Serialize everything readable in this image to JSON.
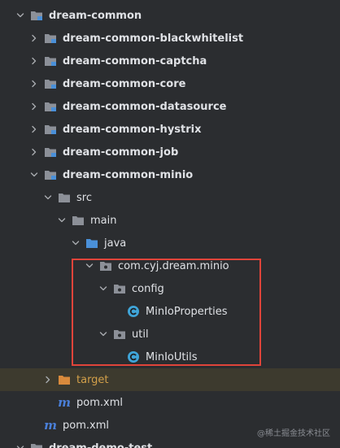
{
  "tree": {
    "rows": [
      {
        "label": "dream-common",
        "depth": 0,
        "expanded": true,
        "icon": "module-folder-icon",
        "bold": true
      },
      {
        "label": "dream-common-blackwhitelist",
        "depth": 1,
        "expanded": false,
        "icon": "module-folder-icon",
        "bold": true
      },
      {
        "label": "dream-common-captcha",
        "depth": 1,
        "expanded": false,
        "icon": "module-folder-icon",
        "bold": true
      },
      {
        "label": "dream-common-core",
        "depth": 1,
        "expanded": false,
        "icon": "module-folder-icon",
        "bold": true
      },
      {
        "label": "dream-common-datasource",
        "depth": 1,
        "expanded": false,
        "icon": "module-folder-icon",
        "bold": true
      },
      {
        "label": "dream-common-hystrix",
        "depth": 1,
        "expanded": false,
        "icon": "module-folder-icon",
        "bold": true
      },
      {
        "label": "dream-common-job",
        "depth": 1,
        "expanded": false,
        "icon": "module-folder-icon",
        "bold": true
      },
      {
        "label": "dream-common-minio",
        "depth": 1,
        "expanded": true,
        "icon": "module-folder-icon",
        "bold": true
      },
      {
        "label": "src",
        "depth": 2,
        "expanded": true,
        "icon": "folder-icon",
        "bold": false
      },
      {
        "label": "main",
        "depth": 3,
        "expanded": true,
        "icon": "folder-icon",
        "bold": false
      },
      {
        "label": "java",
        "depth": 4,
        "expanded": true,
        "icon": "source-folder-icon",
        "bold": false
      },
      {
        "label": "com.cyj.dream.minio",
        "depth": 5,
        "expanded": true,
        "icon": "package-icon",
        "bold": false
      },
      {
        "label": "config",
        "depth": 6,
        "expanded": true,
        "icon": "package-icon",
        "bold": false
      },
      {
        "label": "MinIoProperties",
        "depth": 7,
        "expanded": null,
        "icon": "java-class-icon",
        "bold": false
      },
      {
        "label": "util",
        "depth": 6,
        "expanded": true,
        "icon": "package-icon",
        "bold": false
      },
      {
        "label": "MinIoUtils",
        "depth": 7,
        "expanded": null,
        "icon": "java-class-icon",
        "bold": false
      },
      {
        "label": "target",
        "depth": 2,
        "expanded": false,
        "icon": "excluded-folder-icon",
        "bold": false,
        "highlight": true
      },
      {
        "label": "pom.xml",
        "depth": 2,
        "expanded": null,
        "icon": "maven-icon",
        "bold": false
      },
      {
        "label": "pom.xml",
        "depth": 1,
        "expanded": null,
        "icon": "maven-icon",
        "bold": false
      },
      {
        "label": "dream-demo-test",
        "depth": 0,
        "expanded": true,
        "icon": "module-folder-icon",
        "bold": true
      }
    ]
  },
  "colors": {
    "background": "#2b2d30",
    "text": "#dfe1e5",
    "folder": "#8c9098",
    "source_folder": "#4a90d9",
    "excluded_folder": "#d98a3c",
    "class_icon": "#3fa4d8",
    "selection_box": "#e0443a"
  },
  "watermark": "@稀土掘金技术社区"
}
